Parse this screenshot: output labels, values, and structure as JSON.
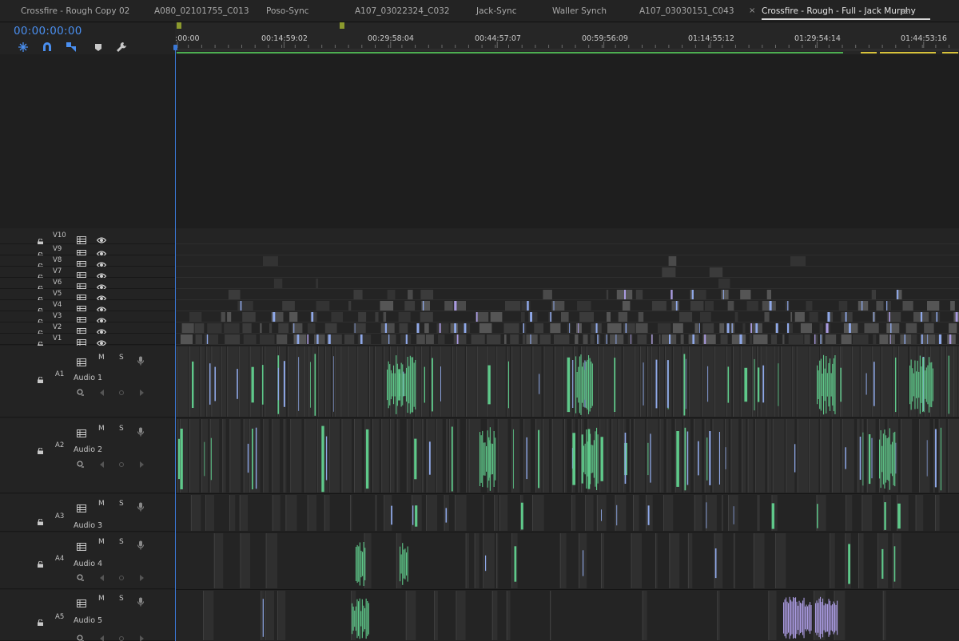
{
  "tabs": [
    {
      "label": "Crossfire - Rough Copy 02",
      "active": false
    },
    {
      "label": "A080_02101755_C013",
      "active": false
    },
    {
      "label": "Poso-Sync",
      "active": false
    },
    {
      "label": "A107_03022324_C032",
      "active": false
    },
    {
      "label": "Jack-Sync",
      "active": false
    },
    {
      "label": "Waller Synch",
      "active": false
    },
    {
      "label": "A107_03030151_C043",
      "active": false
    },
    {
      "label": "Crossfire - Rough - Full - Jack Murphy",
      "active": true
    }
  ],
  "tab_close_glyph": "×",
  "tab_menu_glyph": "≡",
  "timecode": "00:00:00:00",
  "toolbar_icons": [
    "nest-icon",
    "snap-magnet-icon",
    "linked-selection-icon",
    "add-marker-icon",
    "settings-wrench-icon"
  ],
  "ruler_labels": [
    ":00:00",
    "00:14:59:02",
    "00:29:58:04",
    "00:44:57:07",
    "00:59:56:09",
    "01:14:55:12",
    "01:29:54:14",
    "01:44:53:16"
  ],
  "video_tracks": [
    "V10",
    "V9",
    "V8",
    "V7",
    "V6",
    "V5",
    "V4",
    "V3",
    "V2",
    "V1"
  ],
  "audio_tracks": [
    {
      "code": "A1",
      "name": "Audio 1"
    },
    {
      "code": "A2",
      "name": "Audio 2"
    },
    {
      "code": "A3",
      "name": "Audio 3"
    },
    {
      "code": "A4",
      "name": "Audio 4"
    },
    {
      "code": "A5",
      "name": "Audio 5"
    }
  ],
  "audio_buttons": {
    "mute": "M",
    "solo": "S"
  },
  "audio_clip_marker": "L",
  "colors": {
    "timecode": "#4a8ff0",
    "playhead": "#3a78d6",
    "audio_clip_green": "#5fc98a",
    "video_clip_blue": "#8fa8e8",
    "clip_lavender": "#a99ae0",
    "work_area_green": "#4caf50",
    "render_yellow": "#d8c23a",
    "marker_olive": "#8c9a2e"
  }
}
